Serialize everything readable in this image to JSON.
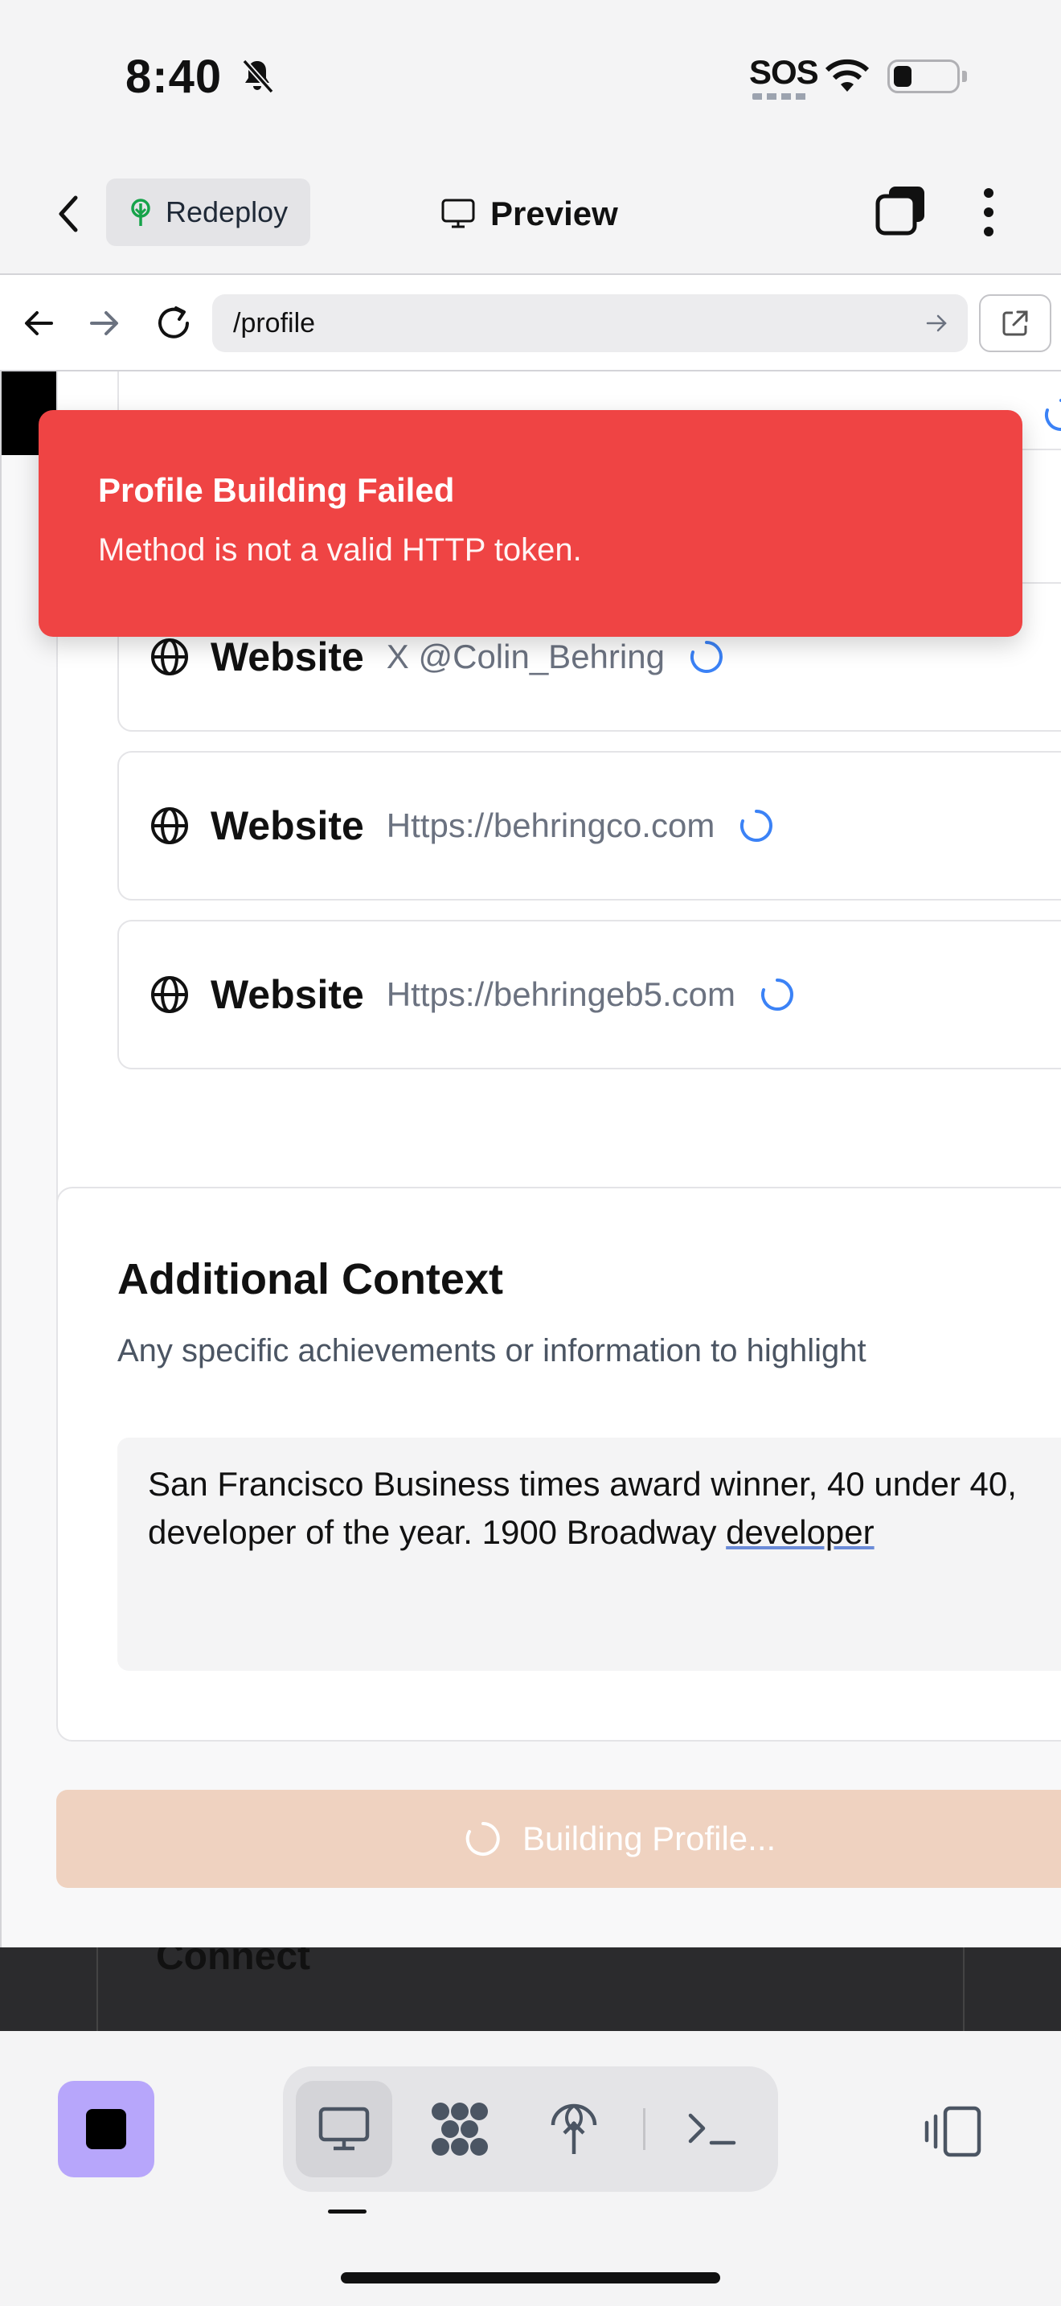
{
  "status_bar": {
    "time": "8:40",
    "sos": "SOS"
  },
  "header": {
    "redeploy_label": "Redeploy",
    "preview_label": "Preview"
  },
  "browser": {
    "url": "/profile"
  },
  "websites": [
    {
      "label": "Website",
      "value": "X @Colin_Behring"
    },
    {
      "label": "Website",
      "value": "Https://behringco.com"
    },
    {
      "label": "Website",
      "value": "Https://behringeb5.com"
    }
  ],
  "context": {
    "title": "Additional Context",
    "description": "Any specific achievements or information to highlight",
    "text_main": "San Francisco Business times award winner, 40 under 40, developer of the year. 1900 Broadway ",
    "text_underlined": "developer"
  },
  "build_button": {
    "label": "Building Profile..."
  },
  "background_heading": "Connect",
  "toast": {
    "title": "Profile Building Failed",
    "message": "Method is not a valid HTTP token."
  },
  "colors": {
    "toast_bg": "#ef4444",
    "build_button_bg": "#efd2c0",
    "stop_button_bg": "#b7a6fb",
    "spinner": "#3b82f6"
  },
  "icons": [
    "bell-slash-icon",
    "wifi-icon",
    "battery-icon",
    "chevron-left-icon",
    "tree-icon",
    "monitor-icon",
    "tabs-icon",
    "kebab-icon",
    "arrow-left-icon",
    "arrow-right-icon",
    "reload-icon",
    "external-link-icon",
    "globe-icon",
    "spinner-icon",
    "stop-icon",
    "puzzle-icon",
    "deploy-icon",
    "terminal-icon",
    "layout-icon"
  ]
}
